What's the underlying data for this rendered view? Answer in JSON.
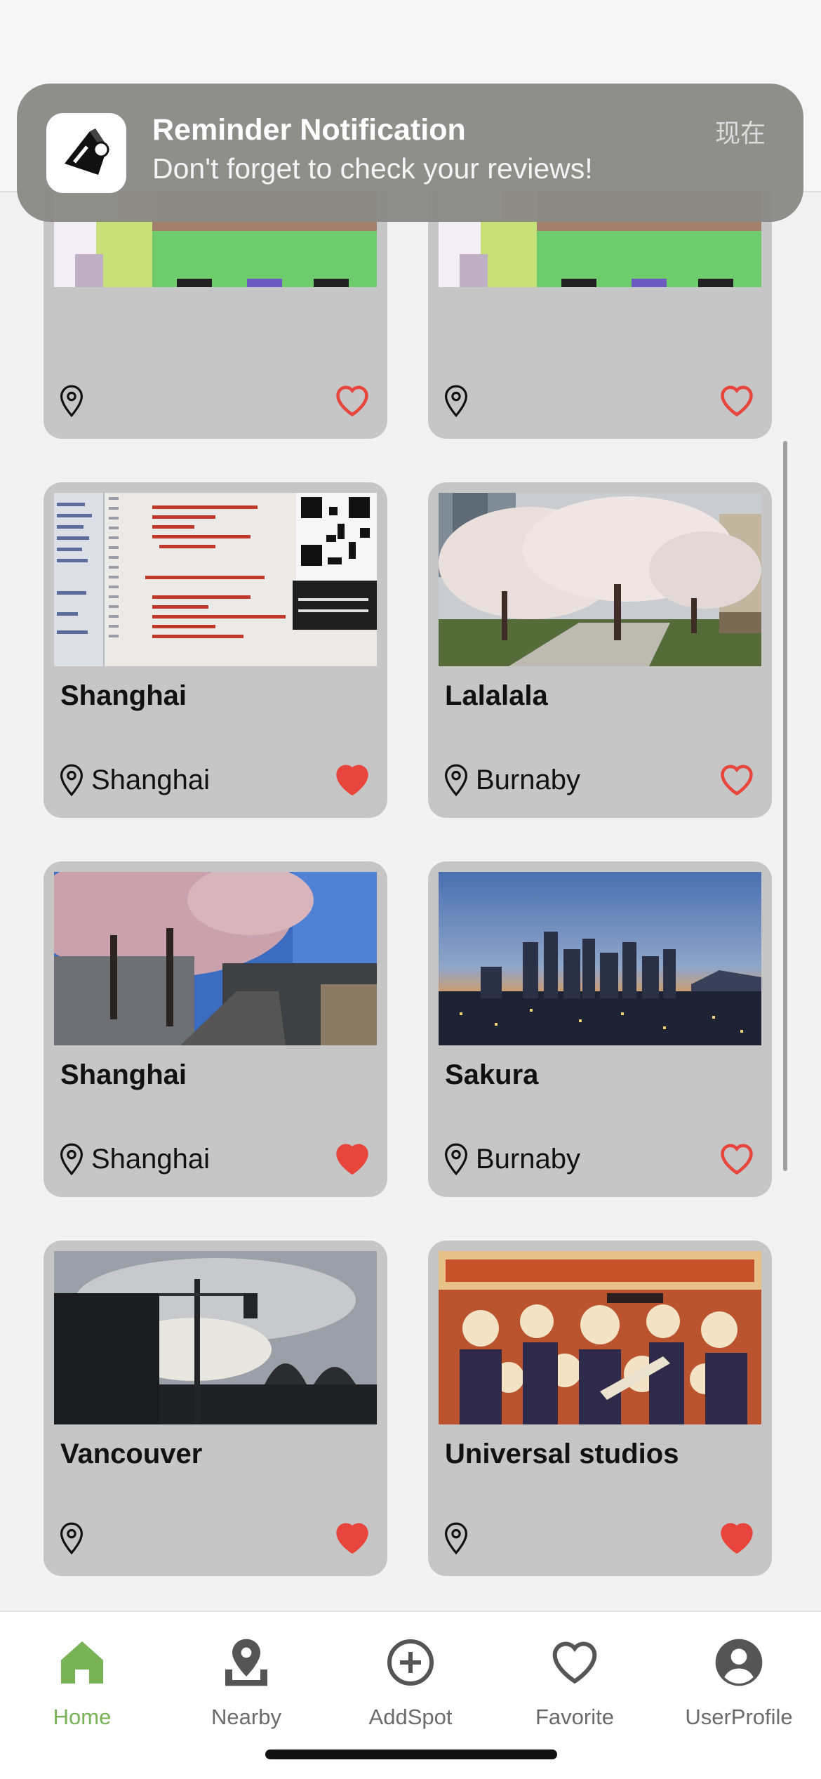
{
  "notification": {
    "title": "Reminder Notification",
    "body": "Don't forget to check your reviews!",
    "time": "现在"
  },
  "spots": [
    {
      "title": "",
      "location": "",
      "favorite": false,
      "image": "pixel-art"
    },
    {
      "title": "",
      "location": "",
      "favorite": false,
      "image": "pixel-art"
    },
    {
      "title": "Shanghai",
      "location": "Shanghai",
      "favorite": true,
      "image": "code-screenshot"
    },
    {
      "title": "Lalalala",
      "location": "Burnaby",
      "favorite": false,
      "image": "cherry-tree"
    },
    {
      "title": "Shanghai",
      "location": "Shanghai",
      "favorite": true,
      "image": "cherry-street"
    },
    {
      "title": "Sakura",
      "location": "Burnaby",
      "favorite": false,
      "image": "city-skyline"
    },
    {
      "title": "Vancouver",
      "location": "",
      "favorite": true,
      "image": "sunset-street"
    },
    {
      "title": "Universal studios",
      "location": "",
      "favorite": true,
      "image": "coco-poster"
    }
  ],
  "tabs": [
    {
      "label": "Home",
      "icon": "home-icon",
      "active": true
    },
    {
      "label": "Nearby",
      "icon": "map-pin-icon",
      "active": false
    },
    {
      "label": "AddSpot",
      "icon": "add-circle-icon",
      "active": false
    },
    {
      "label": "Favorite",
      "icon": "heart-icon",
      "active": false
    },
    {
      "label": "UserProfile",
      "icon": "user-circle-icon",
      "active": false
    }
  ],
  "colors": {
    "accent": "#77b255",
    "favorite": "#e8453c",
    "card": "#c6c6c6",
    "tab_inactive": "#6b6b6b"
  }
}
